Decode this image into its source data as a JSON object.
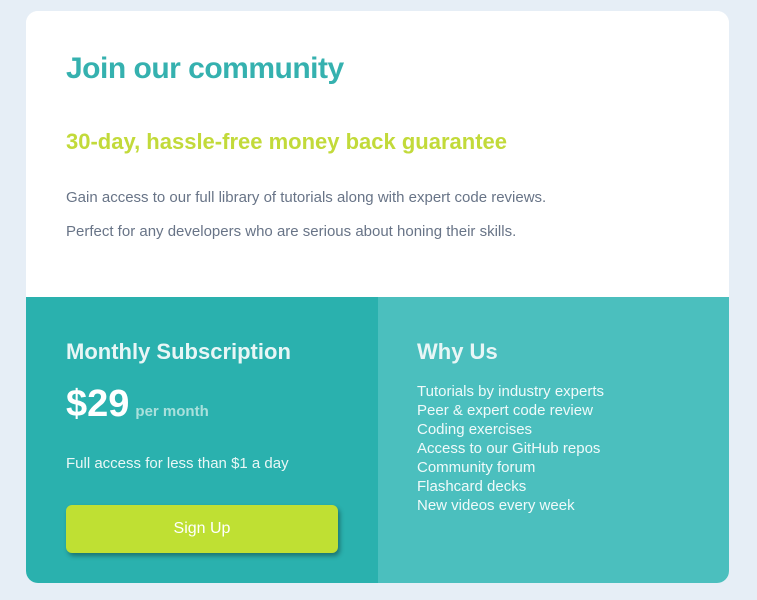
{
  "header": {
    "title": "Join our community",
    "guarantee": "30-day, hassle-free money back guarantee",
    "description_1": "Gain access to our full library of tutorials along with expert code reviews.",
    "description_2": "Perfect for any developers who are serious about honing their skills."
  },
  "subscription": {
    "title": "Monthly Subscription",
    "price": "$29",
    "period": "per month",
    "access_text": "Full access for less than $1 a day",
    "signup_label": "Sign Up"
  },
  "why": {
    "title": "Why Us",
    "items": [
      "Tutorials by industry experts",
      "Peer & expert code review",
      "Coding exercises",
      "Access to our GitHub repos",
      "Community forum",
      "Flashcard decks",
      "New videos every week"
    ]
  },
  "colors": {
    "page_background": "#e6eef6",
    "heading": "#35b1af",
    "guarantee": "#c2da3a",
    "subscription_panel": "#2ab1ae",
    "why_panel": "#4bbfbe",
    "button": "#bfe033"
  }
}
